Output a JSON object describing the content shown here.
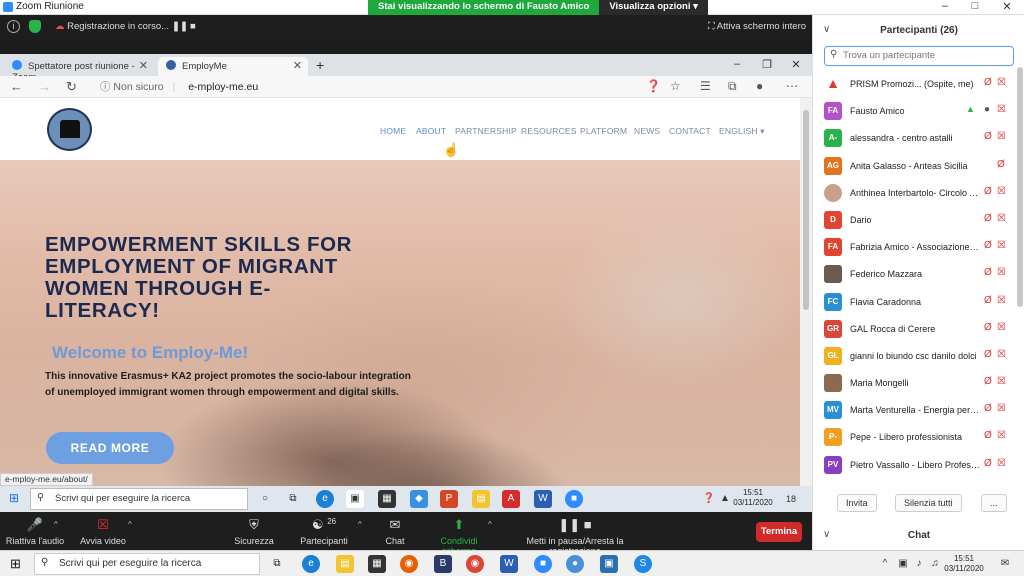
{
  "zoom": {
    "window_title": "Zoom Riunione",
    "share_banner": "Stai visualizzando lo schermo di Fausto Amico",
    "view_options": "Visualizza opzioni ▾",
    "recording": "Registrazione in corso...",
    "fullscreen": "Attiva schermo intero",
    "bottom": {
      "audio": "Riattiva l'audio",
      "video": "Avvia video",
      "security": "Sicurezza",
      "participants": "Partecipanti",
      "participants_count": "26",
      "chat": "Chat",
      "share": "Condividi schermo",
      "record": "Metti in pausa/Arresta la registrazione",
      "end": "Termina"
    }
  },
  "browser": {
    "tabs": [
      {
        "label": "Spettatore post riunione - Zoom"
      },
      {
        "label": "EmployMe"
      }
    ],
    "security": "Non sicuro",
    "url": "e-mploy-me.eu",
    "status_url": "e-mploy-me.eu/about/"
  },
  "site": {
    "nav": [
      "HOME",
      "ABOUT",
      "PARTNERSHIP",
      "RESOURCES",
      "PLATFORM",
      "NEWS",
      "CONTACT",
      "ENGLISH ▾"
    ],
    "hero_title": "EMPOWERMENT SKILLS FOR EMPLOYMENT OF MIGRANT WOMEN THROUGH E-LITERACY!",
    "welcome": "Welcome to Employ-Me!",
    "description": "This innovative Erasmus+ KA2 project promotes the socio-labour integration of unemployed immigrant women through empowerment and digital skills.",
    "read_more": "READ MORE"
  },
  "inner_taskbar": {
    "search": "Scrivi qui per eseguire la ricerca",
    "time": "15:51",
    "date": "03/11/2020",
    "badge": "18"
  },
  "outer_taskbar": {
    "search": "Scrivi qui per eseguire la ricerca",
    "time": "15:51",
    "date": "03/11/2020"
  },
  "panel": {
    "title": "Partecipanti (26)",
    "search_placeholder": "Trova un partecipante",
    "participants": [
      {
        "initials": "",
        "name": "PRISM Promozi... (Ospite, me)",
        "color": "#ffffff"
      },
      {
        "initials": "FA",
        "name": "Fausto Amico",
        "color": "#b452c8"
      },
      {
        "initials": "A-",
        "name": "alessandra - centro astalli",
        "color": "#2ab34a"
      },
      {
        "initials": "AG",
        "name": "Anita Galasso - Anteas Sicilia",
        "color": "#e2731f"
      },
      {
        "initials": "",
        "name": "Anthinea Interbartolo- Circolo Ar...",
        "color": "#c9a08a"
      },
      {
        "initials": "D",
        "name": "Dario",
        "color": "#e0452f"
      },
      {
        "initials": "FA",
        "name": "Fabrizia Amico - Associazione Le ...",
        "color": "#e0452f"
      },
      {
        "initials": "",
        "name": "Federico Mazzara",
        "color": "#6b5a4e"
      },
      {
        "initials": "FC",
        "name": "Flavia Caradonna",
        "color": "#2b8fd4"
      },
      {
        "initials": "GR",
        "name": "GAL Rocca di Cerere",
        "color": "#d9473a"
      },
      {
        "initials": "GL",
        "name": "gianni lo biundo csc danilo dolci",
        "color": "#f0b020"
      },
      {
        "initials": "",
        "name": "Maria Mongelli",
        "color": "#8a6a50"
      },
      {
        "initials": "MV",
        "name": "Marta Venturella - Energia per i D...",
        "color": "#2b8fd4"
      },
      {
        "initials": "P-",
        "name": "Pepe - Libero professionista",
        "color": "#f0a020"
      },
      {
        "initials": "PV",
        "name": "Pietro Vassallo - Libero Professio...",
        "color": "#8a3fc0"
      }
    ],
    "invite": "Invita",
    "mute_all": "Silenzia tutti",
    "more": "...",
    "chat": "Chat"
  }
}
